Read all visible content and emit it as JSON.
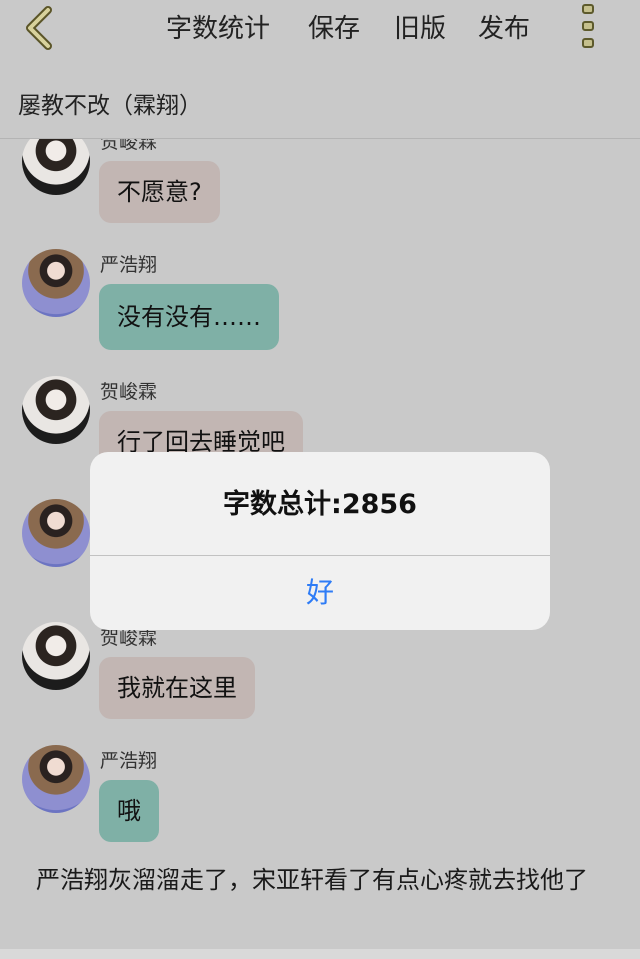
{
  "topbar": {
    "back_icon": "chevron-left-icon",
    "word_count_label": "字数统计",
    "save_label": "保存",
    "old_version_label": "旧版",
    "publish_label": "发布",
    "more_icon": "more-vertical-icon"
  },
  "story": {
    "title": "屡教不改（霖翔）"
  },
  "messages": [
    {
      "sender": "贺峻霖",
      "text": "不愿意?",
      "style": "pink"
    },
    {
      "sender": "严浩翔",
      "text": "没有没有……",
      "style": "teal"
    },
    {
      "sender": "贺峻霖",
      "text": "行了回去睡觉吧",
      "style": "pink"
    },
    {
      "sender": "严浩翔",
      "text": "",
      "style": "teal"
    },
    {
      "sender": "贺峻霖",
      "text": "我就在这里",
      "style": "pink"
    },
    {
      "sender": "严浩翔",
      "text": "哦",
      "style": "teal"
    }
  ],
  "narration": "严浩翔灰溜溜走了，宋亚轩看了有点心疼就去找他了",
  "alert": {
    "message": "字数总计:2856",
    "confirm_label": "好"
  },
  "colors": {
    "accent_blue": "#2e7cf6",
    "bubble_pink": "#c2b6b3",
    "bubble_teal": "#7fb0a6"
  }
}
